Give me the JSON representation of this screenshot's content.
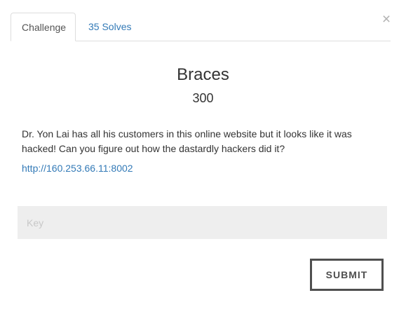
{
  "modal": {
    "close_symbol": "×",
    "close_icon": "close-icon"
  },
  "tabs": [
    {
      "label": "Challenge",
      "active": true
    },
    {
      "label": "35 Solves",
      "active": false
    }
  ],
  "challenge": {
    "name": "Braces",
    "points": "300",
    "description": "Dr. Yon Lai has all his customers in this online website but it looks like it was hacked! Can you figure out how the dastardly hackers did it?",
    "link": "http://160.253.66.11:8002"
  },
  "form": {
    "key_placeholder": "Key",
    "key_value": "",
    "submit_label": "SUBMIT"
  },
  "colors": {
    "link": "#337ab7",
    "input_bg": "#eeeeee",
    "button_border": "#4f4f4f",
    "close": "#b3b3b3"
  }
}
